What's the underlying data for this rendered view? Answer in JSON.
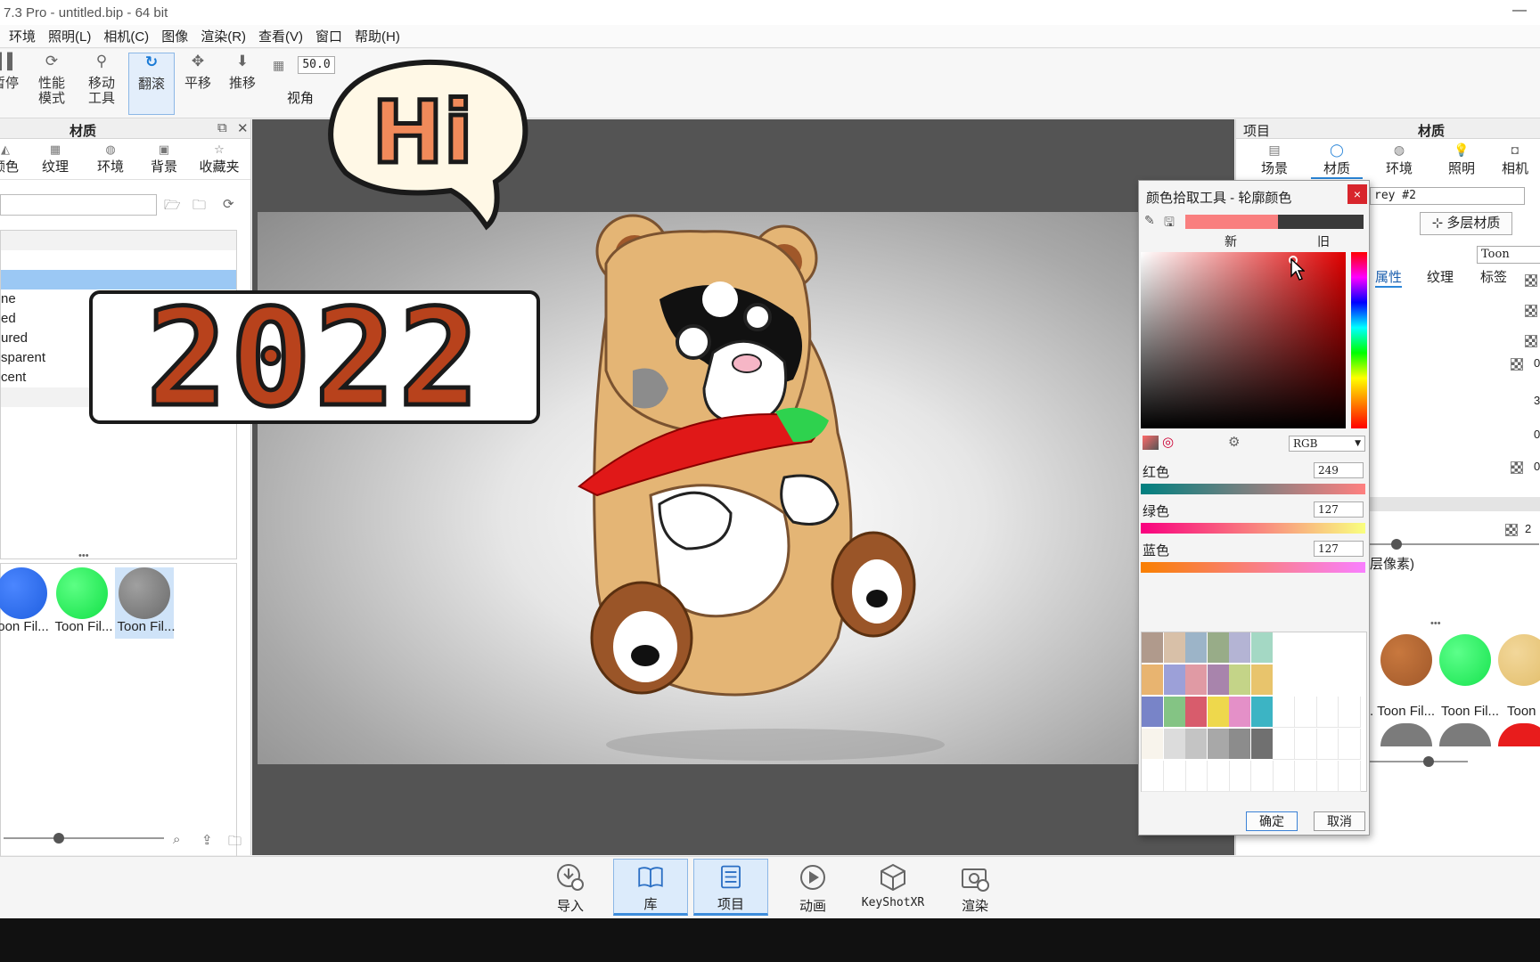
{
  "window": {
    "title": "7.3 Pro - untitled.bip - 64 bit",
    "minimize": "—"
  },
  "menu": [
    "环境",
    "照明(L)",
    "相机(C)",
    "图像",
    "渲染(R)",
    "查看(V)",
    "窗口",
    "帮助(H)"
  ],
  "toolbar": {
    "pause": "暂停",
    "perf_line1": "性能",
    "perf_line2": "模式",
    "move_line1": "移动",
    "move_line2": "工具",
    "tumble": "翻滚",
    "pan": "平移",
    "dolly": "推移",
    "fov_value": "50.0",
    "fov_label": "视角"
  },
  "left_panel": {
    "title": "材质",
    "tabs": [
      "颜色",
      "纹理",
      "环境",
      "背景",
      "收藏夹"
    ],
    "tree_items": [
      "ne",
      "ed",
      "ured",
      "sparent",
      "cent"
    ],
    "thumbs": [
      {
        "label": "oon Fil...",
        "color": "#1f5fe0"
      },
      {
        "label": "Toon Fil...",
        "color": "#12e046"
      },
      {
        "label": "Toon Fil...",
        "color": "#7a7a7a"
      }
    ],
    "more": "•••"
  },
  "right_panel": {
    "project_label": "项目",
    "title": "材质",
    "tabs": [
      "场景",
      "材质",
      "环境",
      "照明",
      "相机"
    ],
    "material_name": "rey #2",
    "multi_material": "多层材质",
    "material_type": "Toon",
    "sub_tabs": [
      "属性",
      "纹理",
      "标签"
    ],
    "field_values": [
      "0",
      "3",
      "0",
      "0",
      "2"
    ],
    "pixel_note": "层像素)",
    "more": "•••",
    "balls": [
      {
        "label": ". Toon Fil...",
        "color": "#a0582a"
      },
      {
        "label": "Toon Fil...",
        "color": "#17e34e"
      },
      {
        "label": "Toon",
        "color": "#e2bd6a"
      }
    ],
    "balls_row2": [
      "#7b7b7b",
      "#7b7b7b",
      "#e81c1c"
    ]
  },
  "color_picker": {
    "title": "颜色拾取工具 - 轮廓颜色",
    "close": "×",
    "new_label": "新",
    "old_label": "旧",
    "new_color": "#f97f7f",
    "old_color": "#3a3a3a",
    "mode": "RGB",
    "red_label": "红色",
    "red_value": "249",
    "green_label": "绿色",
    "green_value": "127",
    "blue_label": "蓝色",
    "blue_value": "127",
    "palette": [
      "#b09a8c",
      "#d8c0a8",
      "#9cb4c8",
      "#98ac88",
      "#b4b4d4",
      "#a4d8c4",
      "#e8b470",
      "#9ca0d8",
      "#e09aa4",
      "#a884ac",
      "#c4d488",
      "#e8c46c",
      "#7884c8",
      "#84c484",
      "#d85c6c",
      "#eed84c",
      "#e490c8",
      "#3cb4c4",
      "#f8f4ec",
      "#dcdcdc",
      "#c4c4c4",
      "#a8a8a8",
      "#8c8c8c",
      "#707070"
    ],
    "ok": "确定",
    "cancel": "取消"
  },
  "bottom": [
    "导入",
    "库",
    "项目",
    "动画",
    "KeyShotXR",
    "渲染"
  ],
  "overlay": {
    "hi": "Hi",
    "year": "2022"
  }
}
